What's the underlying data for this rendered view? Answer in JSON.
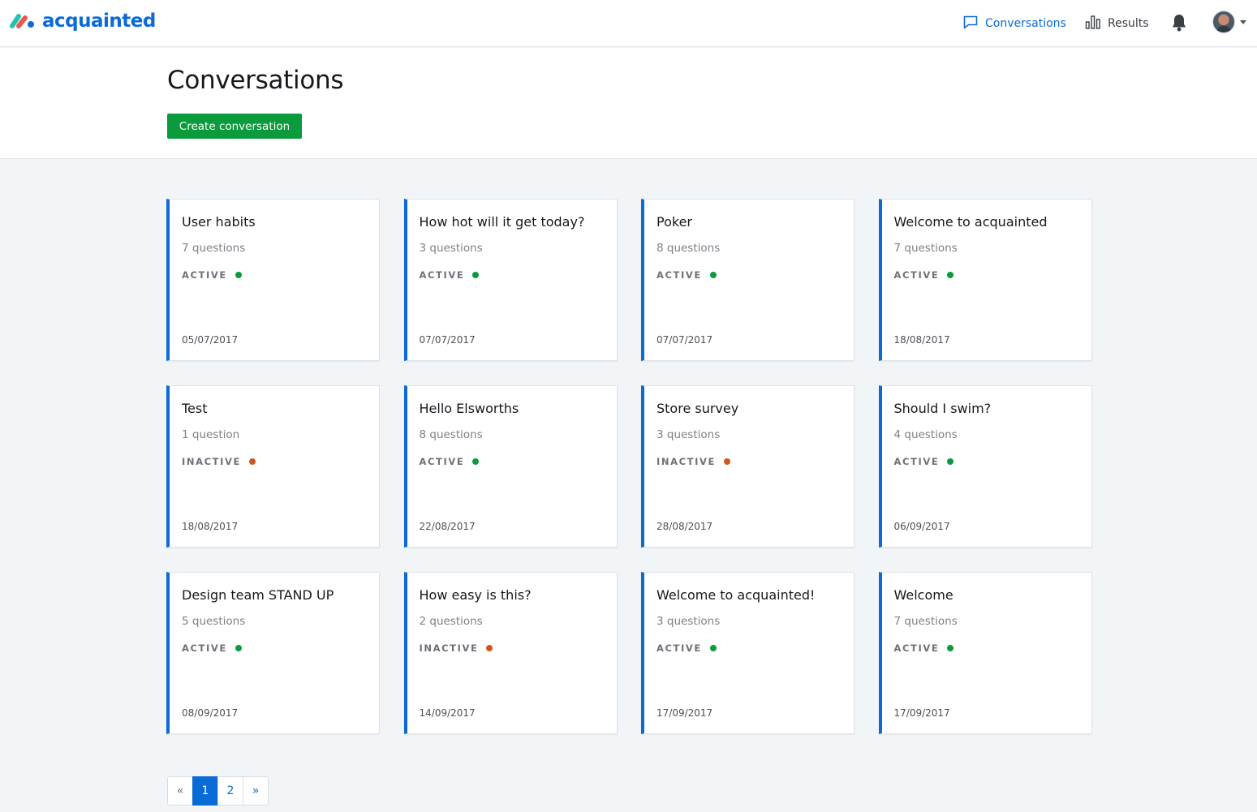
{
  "brand": {
    "name": "acquainted",
    "colors": {
      "primary": "#0b6bd6",
      "green": "#0b9a3c",
      "logo_teal": "#22c3b4",
      "logo_red": "#e8584d",
      "logo_blue": "#0b6bd6"
    }
  },
  "nav": {
    "conversations_label": "Conversations",
    "results_label": "Results",
    "icons": [
      "chat-bubble-icon",
      "bar-chart-icon",
      "bell-icon",
      "avatar",
      "caret-down-icon"
    ]
  },
  "header": {
    "title": "Conversations",
    "create_label": "Create conversation"
  },
  "status_colors": {
    "ACTIVE": "#0b9a3c",
    "INACTIVE": "#d0561b"
  },
  "cards": [
    {
      "title": "User habits",
      "questions": "7 questions",
      "status": "ACTIVE",
      "date": "05/07/2017"
    },
    {
      "title": "How hot will it get today?",
      "questions": "3 questions",
      "status": "ACTIVE",
      "date": "07/07/2017"
    },
    {
      "title": "Poker",
      "questions": "8 questions",
      "status": "ACTIVE",
      "date": "07/07/2017"
    },
    {
      "title": "Welcome to acquainted",
      "questions": "7 questions",
      "status": "ACTIVE",
      "date": "18/08/2017"
    },
    {
      "title": "Test",
      "questions": "1 question",
      "status": "INACTIVE",
      "date": "18/08/2017"
    },
    {
      "title": "Hello Elsworths",
      "questions": "8 questions",
      "status": "ACTIVE",
      "date": "22/08/2017"
    },
    {
      "title": "Store survey",
      "questions": "3 questions",
      "status": "INACTIVE",
      "date": "28/08/2017"
    },
    {
      "title": "Should I swim?",
      "questions": "4 questions",
      "status": "ACTIVE",
      "date": "06/09/2017"
    },
    {
      "title": "Design team STAND UP",
      "questions": "5 questions",
      "status": "ACTIVE",
      "date": "08/09/2017"
    },
    {
      "title": "How easy is this?",
      "questions": "2 questions",
      "status": "INACTIVE",
      "date": "14/09/2017"
    },
    {
      "title": "Welcome to acquainted!",
      "questions": "3 questions",
      "status": "ACTIVE",
      "date": "17/09/2017"
    },
    {
      "title": "Welcome",
      "questions": "7 questions",
      "status": "ACTIVE",
      "date": "17/09/2017"
    }
  ],
  "pagination": {
    "prev": "«",
    "pages": [
      "1",
      "2"
    ],
    "current": "1",
    "next": "»"
  }
}
